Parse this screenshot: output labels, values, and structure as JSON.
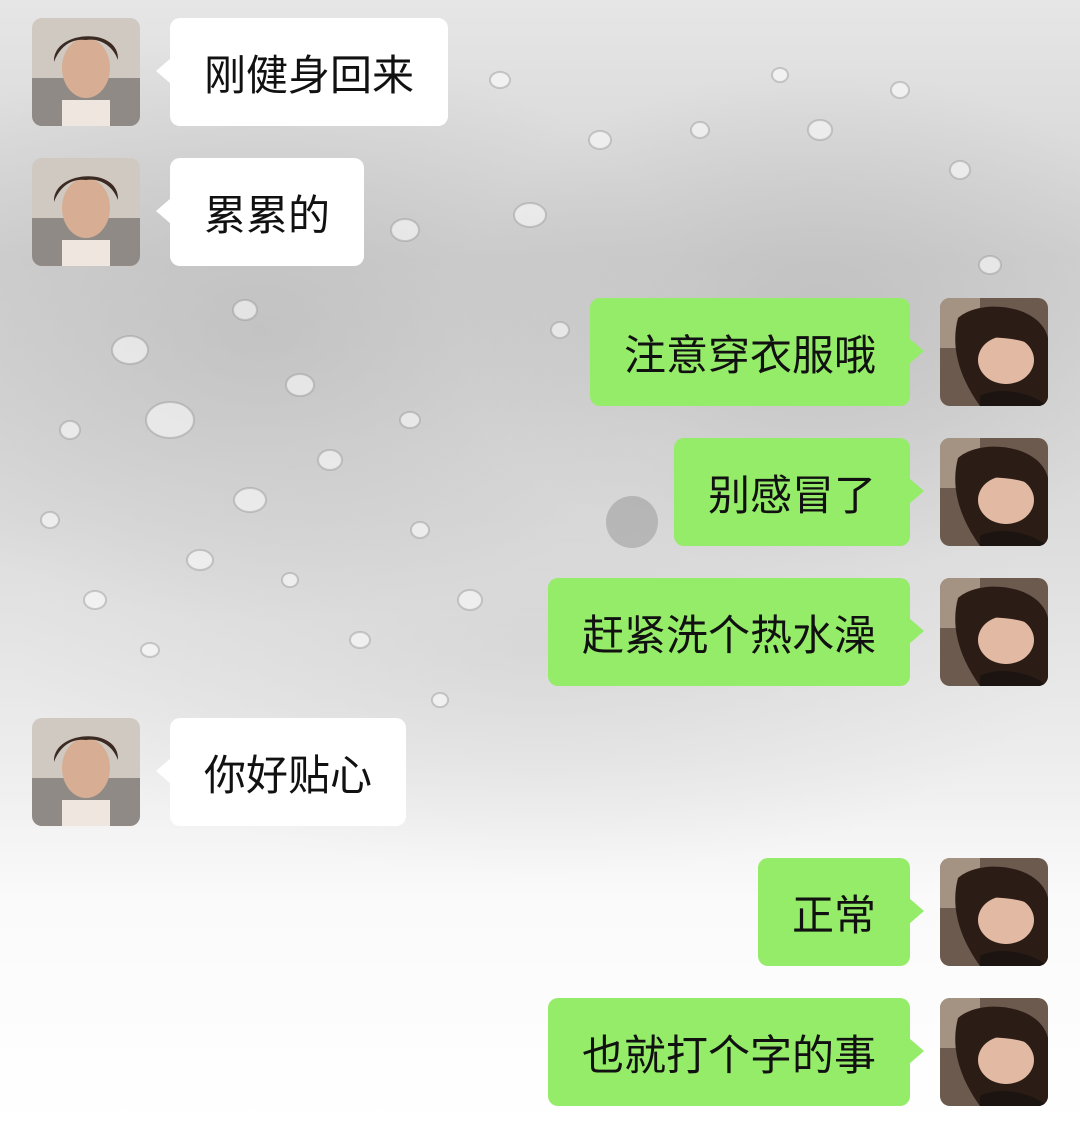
{
  "colors": {
    "incoming_bubble": "#ffffff",
    "outgoing_bubble": "#95ec69",
    "text": "#111111"
  },
  "messages": [
    {
      "sender": "contact",
      "avatar": "contact-avatar",
      "text": "刚健身回来"
    },
    {
      "sender": "contact",
      "avatar": "contact-avatar",
      "text": "累累的"
    },
    {
      "sender": "self",
      "avatar": "self-avatar",
      "text": "注意穿衣服哦"
    },
    {
      "sender": "self",
      "avatar": "self-avatar",
      "text": "别感冒了"
    },
    {
      "sender": "self",
      "avatar": "self-avatar",
      "text": "赶紧洗个热水澡"
    },
    {
      "sender": "contact",
      "avatar": "contact-avatar",
      "text": "你好贴心"
    },
    {
      "sender": "self",
      "avatar": "self-avatar",
      "text": "正常"
    },
    {
      "sender": "self",
      "avatar": "self-avatar",
      "text": "也就打个字的事"
    }
  ]
}
